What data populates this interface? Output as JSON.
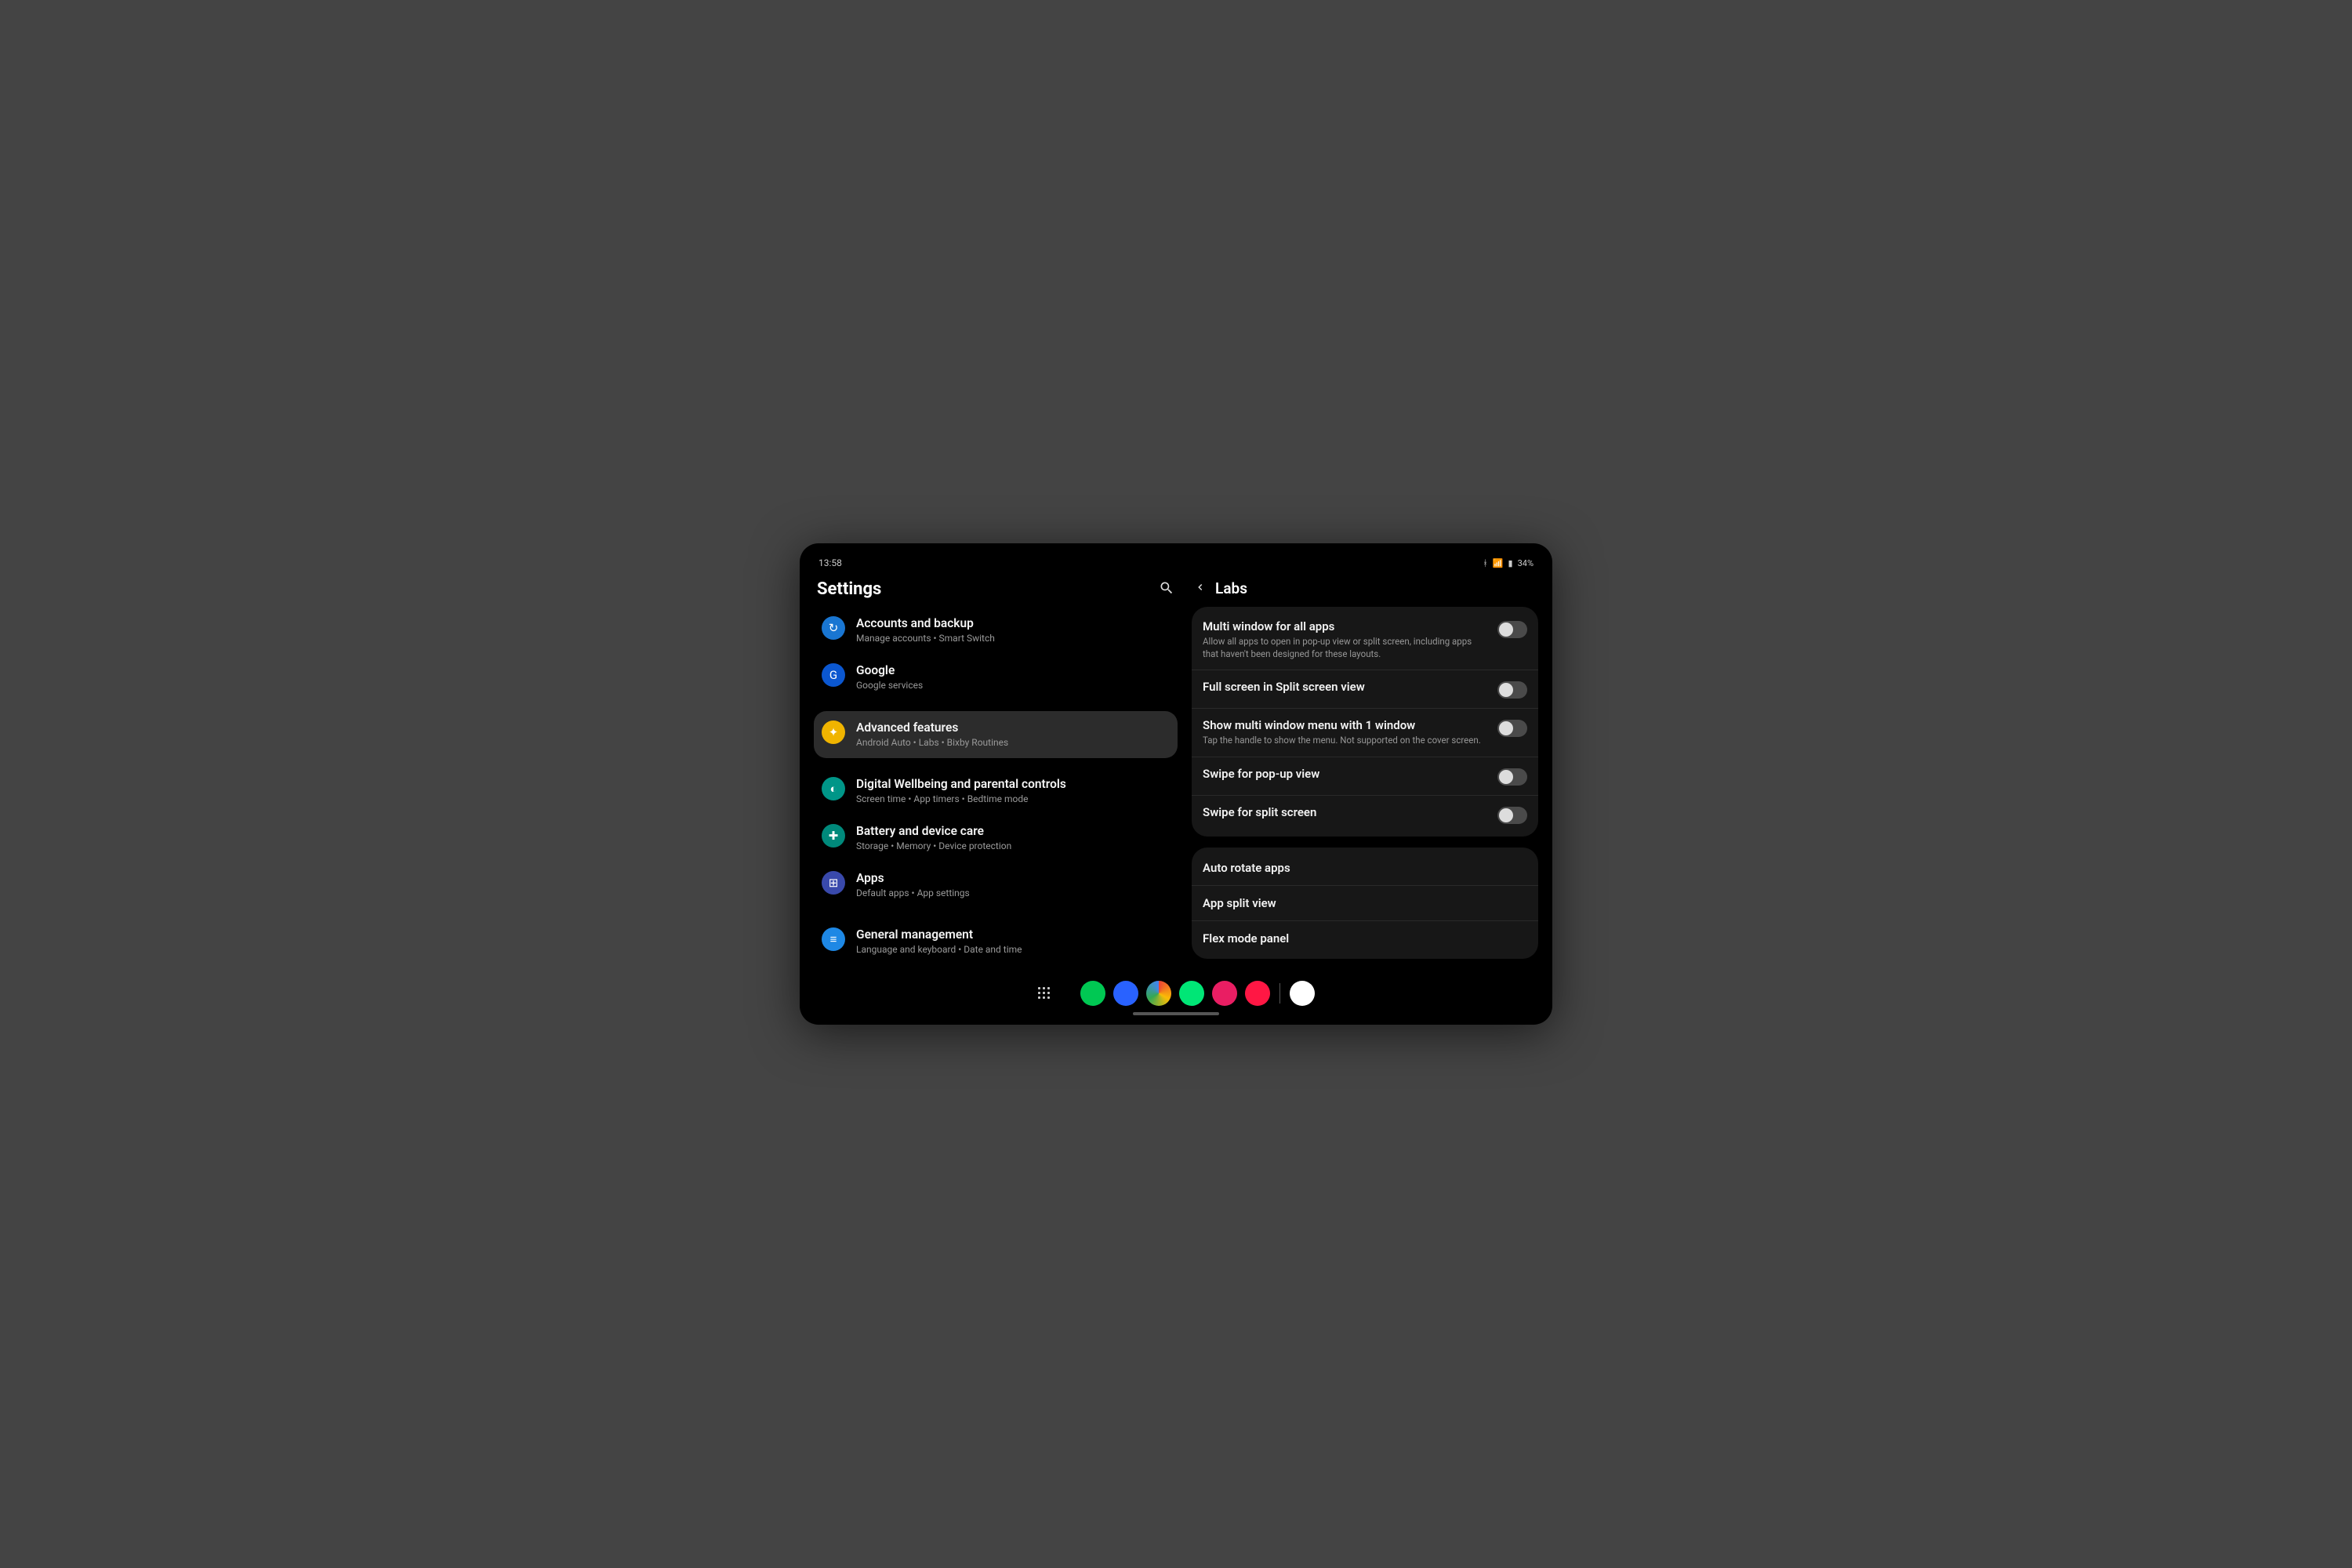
{
  "statusbar": {
    "time": "13:58",
    "battery": "34%"
  },
  "left": {
    "title": "Settings",
    "items": [
      {
        "title": "Accounts and backup",
        "sub": "Manage accounts • Smart Switch",
        "iconClass": "c-blue",
        "icon": "sync-icon",
        "glyph": "↻"
      },
      {
        "title": "Google",
        "sub": "Google services",
        "iconClass": "c-gblue",
        "icon": "google-icon",
        "glyph": "G"
      },
      {
        "title": "Advanced features",
        "sub": "Android Auto • Labs • Bixby Routines",
        "iconClass": "c-yellow",
        "icon": "advanced-icon",
        "glyph": "✦",
        "selected": true
      },
      {
        "title": "Digital Wellbeing and parental controls",
        "sub": "Screen time • App timers • Bedtime mode",
        "iconClass": "c-green",
        "icon": "wellbeing-icon",
        "glyph": "◐"
      },
      {
        "title": "Battery and device care",
        "sub": "Storage • Memory • Device protection",
        "iconClass": "c-teal",
        "icon": "battery-icon",
        "glyph": "✚"
      },
      {
        "title": "Apps",
        "sub": "Default apps • App settings",
        "iconClass": "c-indigo",
        "icon": "apps-icon",
        "glyph": "⊞"
      },
      {
        "title": "General management",
        "sub": "Language and keyboard • Date and time",
        "iconClass": "c-lblue",
        "icon": "general-icon",
        "glyph": "≡"
      }
    ]
  },
  "right": {
    "title": "Labs",
    "group1": [
      {
        "title": "Multi window for all apps",
        "sub": "Allow all apps to open in pop-up view or split screen, including apps that haven't been designed for these layouts.",
        "toggle": true
      },
      {
        "title": "Full screen in Split screen view",
        "sub": "",
        "toggle": true
      },
      {
        "title": "Show multi window menu with 1 window",
        "sub": "Tap the handle to show the menu. Not supported on the cover screen.",
        "toggle": true
      },
      {
        "title": "Swipe for pop-up view",
        "sub": "",
        "toggle": true
      },
      {
        "title": "Swipe for split screen",
        "sub": "",
        "toggle": true
      }
    ],
    "group2": [
      {
        "title": "Auto rotate apps"
      },
      {
        "title": "App split view"
      },
      {
        "title": "Flex mode panel"
      }
    ]
  },
  "dock": [
    {
      "name": "phone-icon",
      "class": "d-green"
    },
    {
      "name": "messages-icon",
      "class": "d-blue"
    },
    {
      "name": "chrome-icon",
      "class": "d-rainbow"
    },
    {
      "name": "whatsapp-icon",
      "class": "d-lime"
    },
    {
      "name": "gallery-icon",
      "class": "d-pink"
    },
    {
      "name": "youtube-icon",
      "class": "d-red"
    },
    {
      "name": "samsung-internet-icon",
      "class": "d-white"
    }
  ]
}
